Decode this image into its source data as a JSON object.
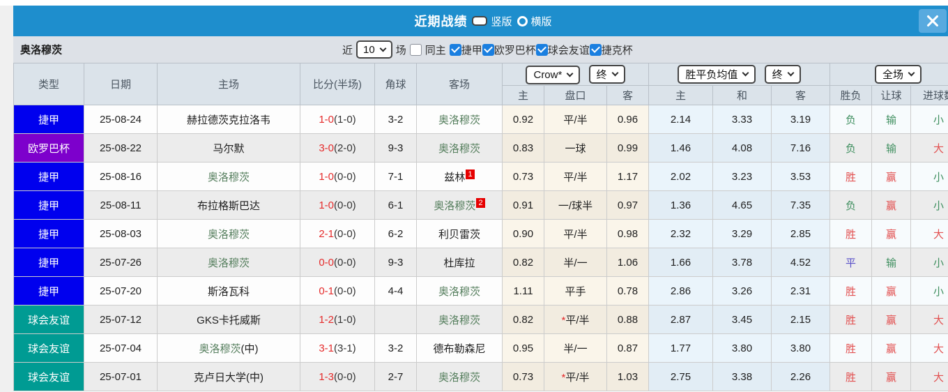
{
  "panel": {
    "title": "近期战绩"
  },
  "view_options": [
    {
      "label": "竖版",
      "selected": true
    },
    {
      "label": "横版",
      "selected": false
    }
  ],
  "filters": {
    "team": "奥洛穆茨",
    "recent_label": "近",
    "recent_value": "10",
    "matches_label": "场",
    "same_home_label": "同主",
    "same_home_checked": false,
    "competitions": [
      {
        "label": "捷甲",
        "checked": true
      },
      {
        "label": "欧罗巴杯",
        "checked": true
      },
      {
        "label": "球会友谊",
        "checked": true
      },
      {
        "label": "捷克杯",
        "checked": true
      }
    ]
  },
  "table": {
    "selectors": {
      "company": "Crow*",
      "company_stage": "终",
      "avg": "胜平负均值",
      "avg_stage": "终",
      "scope": "全场"
    },
    "columns": [
      "类型",
      "日期",
      "主场",
      "比分(半场)",
      "角球",
      "客场",
      "主",
      "盘口",
      "客",
      "主",
      "和",
      "客",
      "胜负",
      "让球",
      "进球数"
    ],
    "badge_colors": {
      "league": "#0000ee",
      "europa": "#7d00cc",
      "friendly": "#009b93"
    },
    "colors": {
      "win": "#e25050",
      "lose": "#3f8f5f",
      "draw": "#5a50c8",
      "score": "#e52b2b",
      "team": "#567f5e",
      "sup_bg": "#e60000",
      "titlebar": "#1e8ecd"
    },
    "rows": [
      {
        "type": "捷甲",
        "badge": "league",
        "date": "25-08-24",
        "home": {
          "name": "赫拉德茨克拉洛韦",
          "team": false,
          "suffix": "",
          "sup": ""
        },
        "score": "1-0",
        "half": "(1-0)",
        "corners": "3-2",
        "away": {
          "name": "奥洛穆茨",
          "team": true,
          "suffix": "",
          "sup": ""
        },
        "odds": [
          "0.92",
          "平/半",
          "0.96"
        ],
        "star": false,
        "avg": [
          "2.14",
          "3.33",
          "3.19"
        ],
        "result": {
          "text": "负",
          "color": "green"
        },
        "spread": {
          "text": "输",
          "color": "green"
        },
        "goals": {
          "text": "小",
          "color": "green"
        }
      },
      {
        "type": "欧罗巴杯",
        "badge": "europa",
        "date": "25-08-22",
        "home": {
          "name": "马尔默",
          "team": false,
          "suffix": "",
          "sup": ""
        },
        "score": "3-0",
        "half": "(2-0)",
        "corners": "9-3",
        "away": {
          "name": "奥洛穆茨",
          "team": true,
          "suffix": "",
          "sup": ""
        },
        "odds": [
          "0.83",
          "一球",
          "0.99"
        ],
        "star": false,
        "avg": [
          "1.46",
          "4.08",
          "7.16"
        ],
        "result": {
          "text": "负",
          "color": "green"
        },
        "spread": {
          "text": "输",
          "color": "green"
        },
        "goals": {
          "text": "大",
          "color": "red"
        }
      },
      {
        "type": "捷甲",
        "badge": "league",
        "date": "25-08-16",
        "home": {
          "name": "奥洛穆茨",
          "team": true,
          "suffix": "",
          "sup": ""
        },
        "score": "1-0",
        "half": "(0-0)",
        "corners": "7-1",
        "away": {
          "name": "兹林",
          "team": false,
          "suffix": "",
          "sup": "1"
        },
        "odds": [
          "0.73",
          "平/半",
          "1.17"
        ],
        "star": false,
        "avg": [
          "2.02",
          "3.23",
          "3.53"
        ],
        "result": {
          "text": "胜",
          "color": "red"
        },
        "spread": {
          "text": "赢",
          "color": "red"
        },
        "goals": {
          "text": "小",
          "color": "green"
        }
      },
      {
        "type": "捷甲",
        "badge": "league",
        "date": "25-08-11",
        "home": {
          "name": "布拉格斯巴达",
          "team": false,
          "suffix": "",
          "sup": ""
        },
        "score": "1-0",
        "half": "(0-0)",
        "corners": "6-1",
        "away": {
          "name": "奥洛穆茨",
          "team": true,
          "suffix": "",
          "sup": "2"
        },
        "odds": [
          "0.91",
          "一/球半",
          "0.97"
        ],
        "star": false,
        "avg": [
          "1.36",
          "4.65",
          "7.35"
        ],
        "result": {
          "text": "负",
          "color": "green"
        },
        "spread": {
          "text": "赢",
          "color": "red"
        },
        "goals": {
          "text": "小",
          "color": "green"
        }
      },
      {
        "type": "捷甲",
        "badge": "league",
        "date": "25-08-03",
        "home": {
          "name": "奥洛穆茨",
          "team": true,
          "suffix": "",
          "sup": ""
        },
        "score": "2-1",
        "half": "(0-0)",
        "corners": "6-2",
        "away": {
          "name": "利贝雷茨",
          "team": false,
          "suffix": "",
          "sup": ""
        },
        "odds": [
          "0.90",
          "平/半",
          "0.98"
        ],
        "star": false,
        "avg": [
          "2.32",
          "3.29",
          "2.85"
        ],
        "result": {
          "text": "胜",
          "color": "red"
        },
        "spread": {
          "text": "赢",
          "color": "red"
        },
        "goals": {
          "text": "大",
          "color": "red"
        }
      },
      {
        "type": "捷甲",
        "badge": "league",
        "date": "25-07-26",
        "home": {
          "name": "奥洛穆茨",
          "team": true,
          "suffix": "",
          "sup": ""
        },
        "score": "0-0",
        "half": "(0-0)",
        "corners": "9-3",
        "away": {
          "name": "杜库拉",
          "team": false,
          "suffix": "",
          "sup": ""
        },
        "odds": [
          "0.82",
          "半/一",
          "1.06"
        ],
        "star": false,
        "avg": [
          "1.66",
          "3.78",
          "4.52"
        ],
        "result": {
          "text": "平",
          "color": "blue"
        },
        "spread": {
          "text": "输",
          "color": "green"
        },
        "goals": {
          "text": "小",
          "color": "green"
        }
      },
      {
        "type": "捷甲",
        "badge": "league",
        "date": "25-07-20",
        "home": {
          "name": "斯洛瓦科",
          "team": false,
          "suffix": "",
          "sup": ""
        },
        "score": "0-1",
        "half": "(0-0)",
        "corners": "4-4",
        "away": {
          "name": "奥洛穆茨",
          "team": true,
          "suffix": "",
          "sup": ""
        },
        "odds": [
          "1.11",
          "平手",
          "0.78"
        ],
        "star": false,
        "avg": [
          "2.86",
          "3.26",
          "2.31"
        ],
        "result": {
          "text": "胜",
          "color": "red"
        },
        "spread": {
          "text": "赢",
          "color": "red"
        },
        "goals": {
          "text": "小",
          "color": "green"
        }
      },
      {
        "type": "球会友谊",
        "badge": "friendly",
        "date": "25-07-12",
        "home": {
          "name": "GKS卡托威斯",
          "team": false,
          "suffix": "",
          "sup": ""
        },
        "score": "1-2",
        "half": "(1-0)",
        "corners": "",
        "away": {
          "name": "奥洛穆茨",
          "team": true,
          "suffix": "",
          "sup": ""
        },
        "odds": [
          "0.82",
          "平/半",
          "0.88"
        ],
        "star": true,
        "avg": [
          "2.87",
          "3.45",
          "2.15"
        ],
        "result": {
          "text": "胜",
          "color": "red"
        },
        "spread": {
          "text": "赢",
          "color": "red"
        },
        "goals": {
          "text": "大",
          "color": "red"
        }
      },
      {
        "type": "球会友谊",
        "badge": "friendly",
        "date": "25-07-04",
        "home": {
          "name": "奥洛穆茨",
          "team": true,
          "suffix": "(中)",
          "sup": ""
        },
        "score": "3-1",
        "half": "(3-1)",
        "corners": "3-2",
        "away": {
          "name": "德布勒森尼",
          "team": false,
          "suffix": "",
          "sup": ""
        },
        "odds": [
          "0.95",
          "半/一",
          "0.87"
        ],
        "star": false,
        "avg": [
          "1.77",
          "3.80",
          "3.80"
        ],
        "result": {
          "text": "胜",
          "color": "red"
        },
        "spread": {
          "text": "赢",
          "color": "red"
        },
        "goals": {
          "text": "大",
          "color": "red"
        }
      },
      {
        "type": "球会友谊",
        "badge": "friendly",
        "date": "25-07-01",
        "home": {
          "name": "克卢日大学(中)",
          "team": false,
          "suffix": "",
          "sup": ""
        },
        "score": "1-3",
        "half": "(0-0)",
        "corners": "2-7",
        "away": {
          "name": "奥洛穆茨",
          "team": true,
          "suffix": "",
          "sup": ""
        },
        "odds": [
          "0.73",
          "平/半",
          "1.03"
        ],
        "star": true,
        "avg": [
          "2.75",
          "3.38",
          "2.26"
        ],
        "result": {
          "text": "胜",
          "color": "red"
        },
        "spread": {
          "text": "赢",
          "color": "red"
        },
        "goals": {
          "text": "大",
          "color": "red"
        }
      }
    ]
  }
}
